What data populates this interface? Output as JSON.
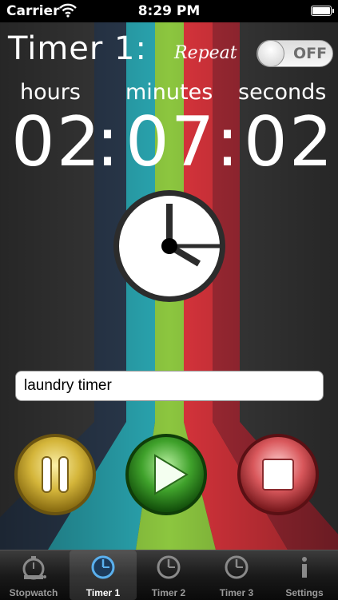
{
  "status_bar": {
    "carrier": "Carrier",
    "time": "8:29 PM"
  },
  "timer": {
    "title": "Timer 1:",
    "repeat_label": "Repeat",
    "repeat_toggle": "OFF",
    "units": {
      "hours": "hours",
      "minutes": "minutes",
      "seconds": "seconds"
    },
    "hours": "02",
    "minutes": "07",
    "seconds": "02",
    "separator": ":",
    "name": "laundry timer"
  },
  "colors": {
    "stripe_navy": "#2b3a4e",
    "stripe_teal": "#2aa6b1",
    "stripe_green": "#8cc63f",
    "stripe_red": "#d9343c",
    "stripe_darkred": "#a32a35"
  },
  "controls": [
    "pause-icon",
    "play-icon",
    "stop-icon"
  ],
  "tabs": [
    {
      "label": "Stopwatch",
      "icon": "stopwatch-icon",
      "active": false
    },
    {
      "label": "Timer 1",
      "icon": "clock-icon",
      "active": true
    },
    {
      "label": "Timer 2",
      "icon": "clock-icon",
      "active": false
    },
    {
      "label": "Timer 3",
      "icon": "clock-icon",
      "active": false
    },
    {
      "label": "Settings",
      "icon": "info-icon",
      "active": false
    }
  ]
}
